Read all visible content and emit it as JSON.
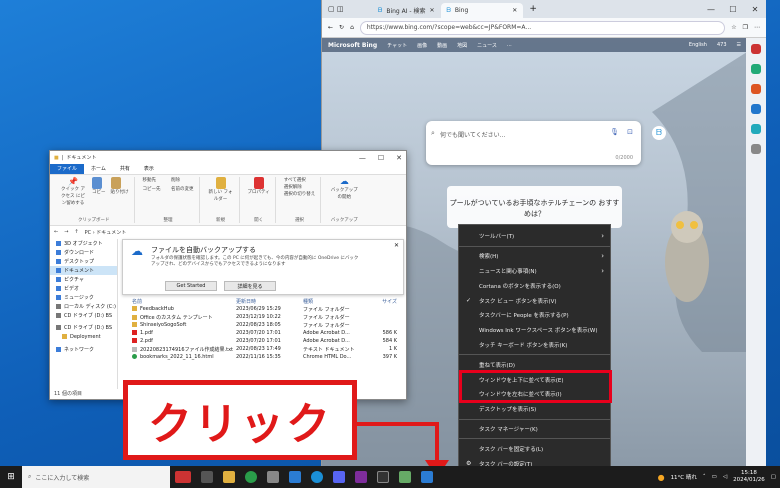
{
  "edge": {
    "tabs": [
      {
        "label": "Bing AI - 検索"
      },
      {
        "label": "Bing"
      }
    ],
    "url": "https://www.bing.com/?scope=web&cc=JP&FORM=A...",
    "nav": {
      "brand": "Microsoft Bing",
      "items": [
        "チャット",
        "画像",
        "動画",
        "地図",
        "ニュース",
        "..."
      ],
      "lang": "English",
      "points": "473"
    },
    "search_placeholder": "何でも聞いてください...",
    "search_counter": "0/2000",
    "carousel_text": "プールがついているお手頃なホテルチェーンの おすすめは？"
  },
  "explorer": {
    "title": "ドキュメント",
    "menus": [
      "ファイル",
      "ホーム",
      "共有",
      "表示"
    ],
    "ribbon_groups": [
      {
        "label": "クリップボード",
        "items": [
          "クイック アクセス にピン留めする",
          "コピー",
          "貼り付け"
        ]
      },
      {
        "label": "整理",
        "items": [
          "移動先",
          "コピー先",
          "削除",
          "名前の変更"
        ]
      },
      {
        "label": "新規",
        "items": [
          "新しい フォルダー"
        ]
      },
      {
        "label": "開く",
        "items": [
          "プロパティ"
        ]
      },
      {
        "label": "選択",
        "items": [
          "すべて選択",
          "選択解除",
          "選択の切り替え"
        ]
      },
      {
        "label": "バックアップ",
        "items": [
          "バックアップ の開始"
        ]
      }
    ],
    "path": "PC › ドキュメント",
    "tree": [
      "3D オブジェクト",
      "ダウンロード",
      "デスクトップ",
      "ドキュメント",
      "ピクチャ",
      "ビデオ",
      "ミュージック",
      "ローカル ディスク (C:)",
      "CD ドライブ (D:) BS",
      "CD ドライブ (D:) BS",
      "Deployment",
      "ネットワーク"
    ],
    "backup": {
      "title": "ファイルを自動バックアップする",
      "desc": "フォルダの保護状態を確認します。この PC に何が起きても、今の内容が自動的に OneDrive にバックアップされ、どのデバイスからでもアクセスできるようになります",
      "btn1": "Get Started",
      "btn2": "詳細を見る"
    },
    "columns": [
      "名前",
      "更新日時",
      "種類",
      "サイズ"
    ],
    "files": [
      {
        "name": "FeedbackHub",
        "date": "2023/06/29 15:29",
        "type": "ファイル フォルダー",
        "size": ""
      },
      {
        "name": "Office のカスタム テンプレート",
        "date": "2023/12/19 10:22",
        "type": "ファイル フォルダー",
        "size": ""
      },
      {
        "name": "ShinseiyoSogoSoft",
        "date": "2022/08/23 18:05",
        "type": "ファイル フォルダー",
        "size": ""
      },
      {
        "name": "1.pdf",
        "date": "2023/07/20 17:01",
        "type": "Adobe Acrobat D...",
        "size": "586 K"
      },
      {
        "name": "2.pdf",
        "date": "2023/07/20 17:01",
        "type": "Adobe Acrobat D...",
        "size": "584 K"
      },
      {
        "name": "20220823174916ファイル作成結果.txt",
        "date": "2022/08/23 17:49",
        "type": "テキスト ドキュメント",
        "size": "1 K"
      },
      {
        "name": "bookmarks_2022_11_16.html",
        "date": "2022/11/16 15:35",
        "type": "Chrome HTML Do...",
        "size": "397 K"
      }
    ],
    "status": "11 個の項目"
  },
  "context_menu": {
    "items": [
      {
        "label": "ツールバー(T)",
        "arrow": true,
        "check": false
      },
      {
        "sep": true
      },
      {
        "label": "検索(H)",
        "arrow": true,
        "check": false
      },
      {
        "label": "ニュースと関心事項(N)",
        "arrow": true,
        "check": false
      },
      {
        "label": "Cortana のボタンを表示する(O)",
        "arrow": false,
        "check": false
      },
      {
        "label": "タスク ビュー ボタンを表示(V)",
        "arrow": false,
        "check": true
      },
      {
        "label": "タスクバーに People を表示する(P)",
        "arrow": false,
        "check": false
      },
      {
        "label": "Windows Ink ワークスペース ボタンを表示(W)",
        "arrow": false,
        "check": false
      },
      {
        "label": "タッチ キーボード ボタンを表示(K)",
        "arrow": false,
        "check": false
      },
      {
        "sep": true
      },
      {
        "label": "重ねて表示(D)",
        "arrow": false,
        "check": false
      },
      {
        "label": "ウィンドウを上下に並べて表示(E)",
        "arrow": false,
        "check": false
      },
      {
        "label": "ウィンドウを左右に並べて表示(I)",
        "arrow": false,
        "check": false
      },
      {
        "label": "デスクトップを表示(S)",
        "arrow": false,
        "check": false
      },
      {
        "sep": true
      },
      {
        "label": "タスク マネージャー(K)",
        "arrow": false,
        "check": false
      },
      {
        "sep": true
      },
      {
        "label": "タスク バーを固定する(L)",
        "arrow": false,
        "check": false
      },
      {
        "label": "タスク バーの設定(T)",
        "arrow": false,
        "check": false,
        "gear": true
      }
    ]
  },
  "overlay": {
    "click_label": "クリック",
    "accent": "#e01919"
  },
  "taskbar": {
    "search_placeholder": "ここに入力して検索",
    "weather": "11°C 晴れ",
    "time": "15:18",
    "date": "2024/01/26"
  }
}
